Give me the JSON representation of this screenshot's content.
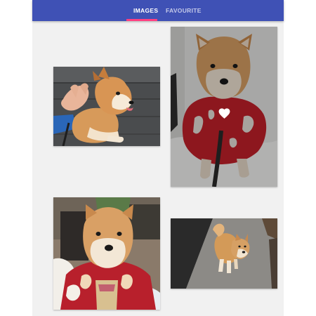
{
  "header": {
    "tabs": [
      {
        "label": "IMAGES",
        "active": true
      },
      {
        "label": "FAVOURITE",
        "active": false
      }
    ],
    "colors": {
      "appbar": "#3f51b5",
      "active_indicator": "#ff4081",
      "background": "#f1f1f1"
    }
  },
  "gallery": {
    "images": [
      {
        "name": "shiba-being-petted",
        "favourite": false
      },
      {
        "name": "shiba-red-jacket-snow",
        "favourite": true,
        "overlay_icon": "heart-icon"
      },
      {
        "name": "shiba-red-kimono",
        "favourite": false
      },
      {
        "name": "shiba-on-pavement",
        "favourite": false
      }
    ]
  }
}
